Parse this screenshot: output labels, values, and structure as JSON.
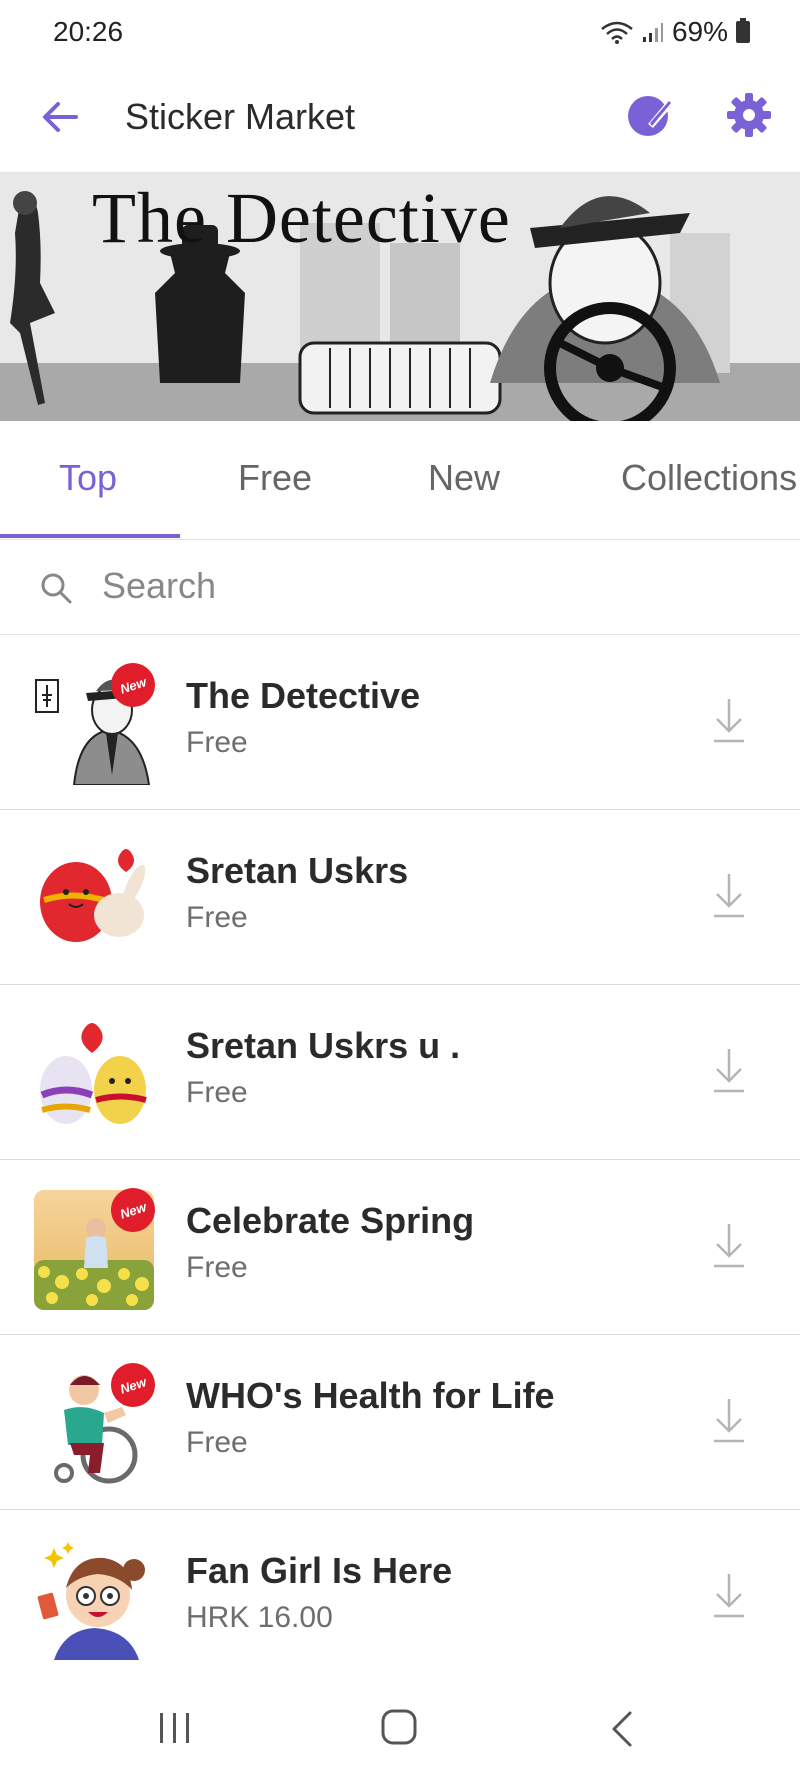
{
  "status_bar": {
    "time": "20:26",
    "battery": "69%"
  },
  "header": {
    "title": "Sticker Market"
  },
  "banner": {
    "title": "The Detective"
  },
  "tabs": [
    {
      "label": "Top",
      "active": true
    },
    {
      "label": "Free",
      "active": false
    },
    {
      "label": "New",
      "active": false
    },
    {
      "label": "Collections",
      "active": false
    }
  ],
  "search": {
    "placeholder": "Search"
  },
  "packs": [
    {
      "name": "The Detective",
      "price": "Free",
      "badge": "New",
      "icon": "detective-thumbnail"
    },
    {
      "name": "Sretan Uskrs",
      "price": "Free",
      "badge": "",
      "icon": "easter-egg-bunny-thumbnail"
    },
    {
      "name": "Sretan Uskrs u .",
      "price": "Free",
      "badge": "",
      "icon": "easter-eggs-heart-thumbnail"
    },
    {
      "name": "Celebrate Spring",
      "price": "Free",
      "badge": "New",
      "icon": "spring-flowers-thumbnail"
    },
    {
      "name": "WHO's Health for Life",
      "price": "Free",
      "badge": "New",
      "icon": "wheelchair-character-thumbnail"
    },
    {
      "name": "Fan Girl Is Here",
      "price": "HRK 16.00",
      "badge": "",
      "icon": "fan-girl-thumbnail"
    }
  ],
  "colors": {
    "accent": "#7a62d6",
    "badge": "#e01e2b",
    "text": "#2b2b2b",
    "subtext": "#6e6e6e"
  }
}
